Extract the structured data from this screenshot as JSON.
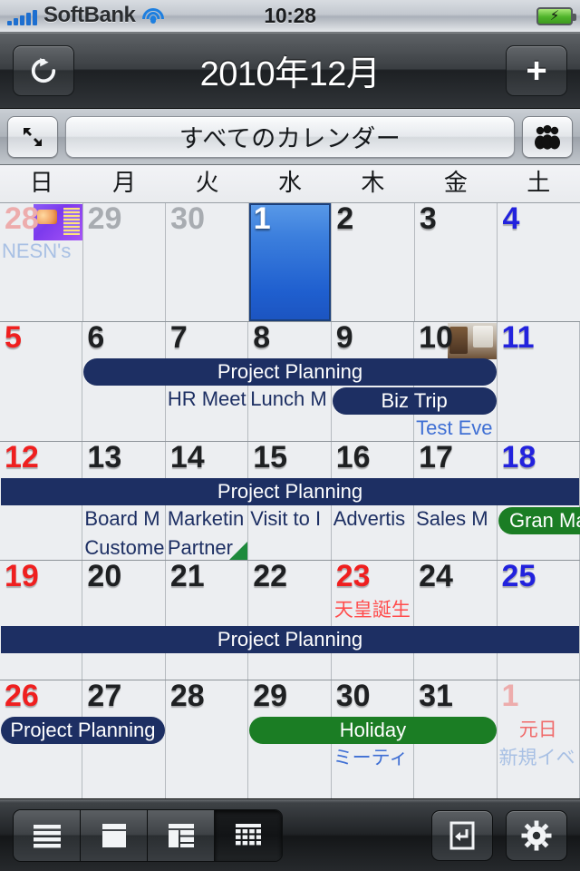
{
  "status_bar": {
    "carrier": "SoftBank",
    "time": "10:28",
    "signal_icon": "signal-bars-icon",
    "wifi_icon": "wifi-icon",
    "battery_icon": "battery-charging-icon"
  },
  "nav_bar": {
    "refresh_icon": "refresh-icon",
    "title": "2010年12月",
    "add_icon": "plus-icon"
  },
  "sub_toolbar": {
    "expand_icon": "expand-arrows-icon",
    "calendar_selector_label": "すべてのカレンダー",
    "people_icon": "people-group-icon"
  },
  "weekdays": [
    "日",
    "月",
    "火",
    "水",
    "木",
    "金",
    "土"
  ],
  "calendar": {
    "selected_day": "1",
    "weeks": [
      {
        "days": [
          {
            "num": "28",
            "type": "out",
            "col": "sun",
            "thumb": "purple",
            "event_text": "NESN's",
            "event_style": "pale-blue"
          },
          {
            "num": "29",
            "type": "out",
            "col": "weekday"
          },
          {
            "num": "30",
            "type": "out",
            "col": "weekday"
          },
          {
            "num": "1",
            "type": "selected",
            "col": "weekday"
          },
          {
            "num": "2",
            "type": "in",
            "col": "weekday"
          },
          {
            "num": "3",
            "type": "in",
            "col": "weekday"
          },
          {
            "num": "4",
            "type": "in",
            "col": "sat"
          }
        ],
        "bars": []
      },
      {
        "days": [
          {
            "num": "5",
            "type": "in",
            "col": "sun"
          },
          {
            "num": "6",
            "type": "in",
            "col": "weekday"
          },
          {
            "num": "7",
            "type": "in",
            "col": "weekday",
            "event_text": "HR Meet",
            "event_style": "navy-text",
            "row": 2
          },
          {
            "num": "8",
            "type": "in",
            "col": "weekday",
            "event_text": "Lunch M",
            "event_style": "navy-text",
            "row": 2
          },
          {
            "num": "9",
            "type": "in",
            "col": "weekday"
          },
          {
            "num": "10",
            "type": "in",
            "col": "weekday",
            "thumb": "photo",
            "event_text": "Test Eve",
            "event_style": "light-blue",
            "row": 3
          },
          {
            "num": "11",
            "type": "in",
            "col": "sat"
          }
        ],
        "bars": [
          {
            "label": "Project Planning",
            "color": "navy",
            "start": 1,
            "end": 5,
            "row": 1,
            "round": "rl"
          },
          {
            "label": "Biz Trip",
            "color": "navy",
            "start": 4,
            "end": 5,
            "row": 2,
            "round": "rl"
          }
        ]
      },
      {
        "days": [
          {
            "num": "12",
            "type": "in",
            "col": "sun"
          },
          {
            "num": "13",
            "type": "in",
            "col": "weekday",
            "event_text": "Board M",
            "event_style": "navy-text",
            "row": 2,
            "event_text2": "Custome"
          },
          {
            "num": "14",
            "type": "in",
            "col": "weekday",
            "event_text": "Marketin",
            "event_style": "navy-text",
            "row": 2,
            "event_text2": "Partner",
            "more": true
          },
          {
            "num": "15",
            "type": "in",
            "col": "weekday",
            "event_text": "Visit to I",
            "event_style": "navy-text",
            "row": 2
          },
          {
            "num": "16",
            "type": "in",
            "col": "weekday",
            "event_text": "Advertis",
            "event_style": "navy-text",
            "row": 2
          },
          {
            "num": "17",
            "type": "in",
            "col": "weekday",
            "event_text": "Sales M",
            "event_style": "navy-text",
            "row": 2
          },
          {
            "num": "18",
            "type": "in",
            "col": "sat"
          }
        ],
        "bars": [
          {
            "label": "Project Planning",
            "color": "navy",
            "start": 0,
            "end": 6,
            "row": 1,
            "round": "sq"
          },
          {
            "label": "Gran Ma",
            "color": "green",
            "start": 6,
            "end": 6,
            "row": 2,
            "round": "rleft",
            "overflow": true
          }
        ]
      },
      {
        "days": [
          {
            "num": "19",
            "type": "in",
            "col": "sun"
          },
          {
            "num": "20",
            "type": "in",
            "col": "weekday"
          },
          {
            "num": "21",
            "type": "in",
            "col": "weekday"
          },
          {
            "num": "22",
            "type": "in",
            "col": "weekday"
          },
          {
            "num": "23",
            "type": "in",
            "col": "holiday",
            "holiday_text": "天皇誕生"
          },
          {
            "num": "24",
            "type": "in",
            "col": "weekday"
          },
          {
            "num": "25",
            "type": "in",
            "col": "sat"
          }
        ],
        "bars": [
          {
            "label": "Project Planning",
            "color": "navy",
            "start": 0,
            "end": 6,
            "row": 2,
            "round": "sq"
          }
        ]
      },
      {
        "days": [
          {
            "num": "26",
            "type": "in",
            "col": "sun"
          },
          {
            "num": "27",
            "type": "in",
            "col": "weekday"
          },
          {
            "num": "28",
            "type": "in",
            "col": "weekday"
          },
          {
            "num": "29",
            "type": "in",
            "col": "weekday"
          },
          {
            "num": "30",
            "type": "in",
            "col": "weekday",
            "event_text": "ミーティ",
            "event_style": "light-blue-jp",
            "row": 2
          },
          {
            "num": "31",
            "type": "in",
            "col": "weekday"
          },
          {
            "num": "1",
            "type": "out",
            "col": "sun",
            "holiday_text": "元日",
            "event_text": "新規イベ",
            "event_style": "pale-blue-jp",
            "row": 2
          }
        ],
        "bars": [
          {
            "label": "Project Planning",
            "color": "navy",
            "start": 0,
            "end": 1,
            "row": 1,
            "round": "rl"
          },
          {
            "label": "Holiday",
            "color": "green",
            "start": 3,
            "end": 5,
            "row": 1,
            "round": "rl"
          }
        ]
      }
    ]
  },
  "tab_bar": {
    "views": [
      {
        "name": "list-view",
        "icon": "list-icon",
        "selected": false
      },
      {
        "name": "day-view",
        "icon": "day-icon",
        "selected": false
      },
      {
        "name": "week-view",
        "icon": "week-icon",
        "selected": false
      },
      {
        "name": "month-view",
        "icon": "month-grid-icon",
        "selected": true
      }
    ],
    "today_icon": "today-return-icon",
    "settings_icon": "gear-icon"
  },
  "colors": {
    "navy_event": "#1d2f63",
    "green_event": "#1b7d24",
    "sunday_red": "#ef1f1f",
    "saturday_blue": "#2222dd",
    "selected_blue": "#1f5fcf"
  }
}
